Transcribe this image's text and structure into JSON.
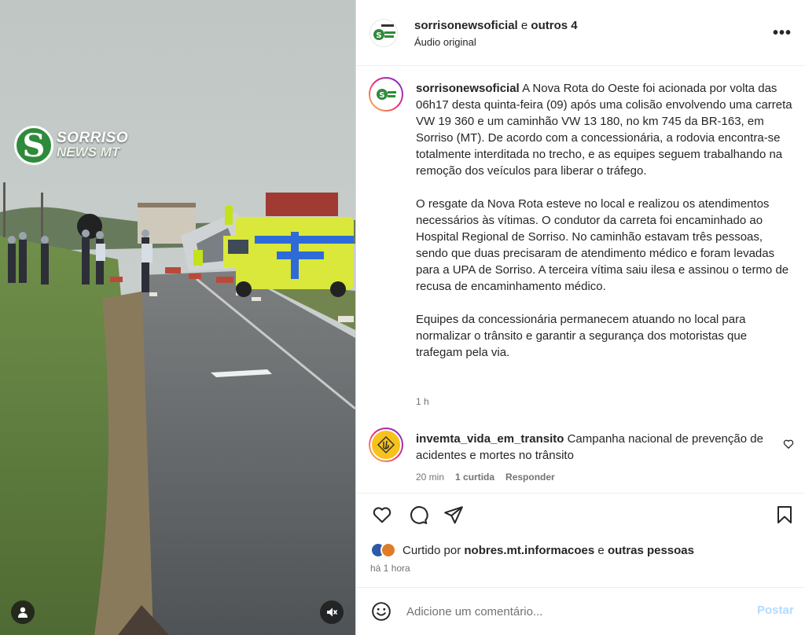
{
  "media": {
    "watermark_line1": "SORRISO",
    "watermark_line2": "NEWS MT",
    "watermark_letter": "S",
    "user_icon": "user-icon",
    "mute_icon": "muted-speaker-icon"
  },
  "header": {
    "username": "sorrisonewsoficial",
    "connector": "e",
    "others": "outros 4",
    "audio": "Áudio original",
    "more_icon": "more-horizontal-icon",
    "more_label": "•••"
  },
  "caption": {
    "username": "sorrisonewsoficial",
    "paragraphs": [
      "A Nova Rota do Oeste foi acionada por volta das 06h17 desta quinta-feira (09) após uma colisão envolvendo uma carreta VW 19 360 e um caminhão VW 13 180, no km 745 da BR-163, em Sorriso (MT). De acordo com a concessionária, a rodovia encontra-se totalmente interditada no trecho, e as equipes seguem trabalhando na remoção dos veículos para liberar o tráfego.",
      "O resgate da Nova Rota esteve no local e realizou os atendimentos necessários às vítimas. O condutor da carreta foi encaminhado ao Hospital Regional de Sorriso. No caminhão estavam três pessoas, sendo que duas precisaram de atendimento médico e foram levadas para a UPA de Sorriso. A terceira vítima saiu ilesa e assinou o termo de recusa de encaminhamento médico.",
      "Equipes da concessionária permanecem atuando no local para normalizar o trânsito e garantir a segurança dos motoristas que trafegam pela via."
    ],
    "time": "1 h"
  },
  "comment": {
    "username": "invemta_vida_em_transito",
    "text": "Campanha nacional de prevenção de acidentes e mortes no trânsito",
    "time": "20 min",
    "likes": "1 curtida",
    "reply": "Responder",
    "like_icon": "heart-outline-icon"
  },
  "actions": {
    "like_icon": "heart-outline-icon",
    "comment_icon": "comment-bubble-icon",
    "share_icon": "paper-plane-icon",
    "save_icon": "bookmark-icon"
  },
  "likes": {
    "prefix": "Curtido por",
    "user": "nobres.mt.informacoes",
    "connector": "e",
    "others": "outras pessoas"
  },
  "timeago": "há 1 hora",
  "add_comment": {
    "placeholder": "Adicione um comentário...",
    "post": "Postar",
    "emoji_icon": "smiley-face-icon"
  },
  "colors": {
    "text": "#262626",
    "secondary": "#737373",
    "post_disabled": "#b3dbff",
    "watermark_green": "#2e8b3a"
  }
}
